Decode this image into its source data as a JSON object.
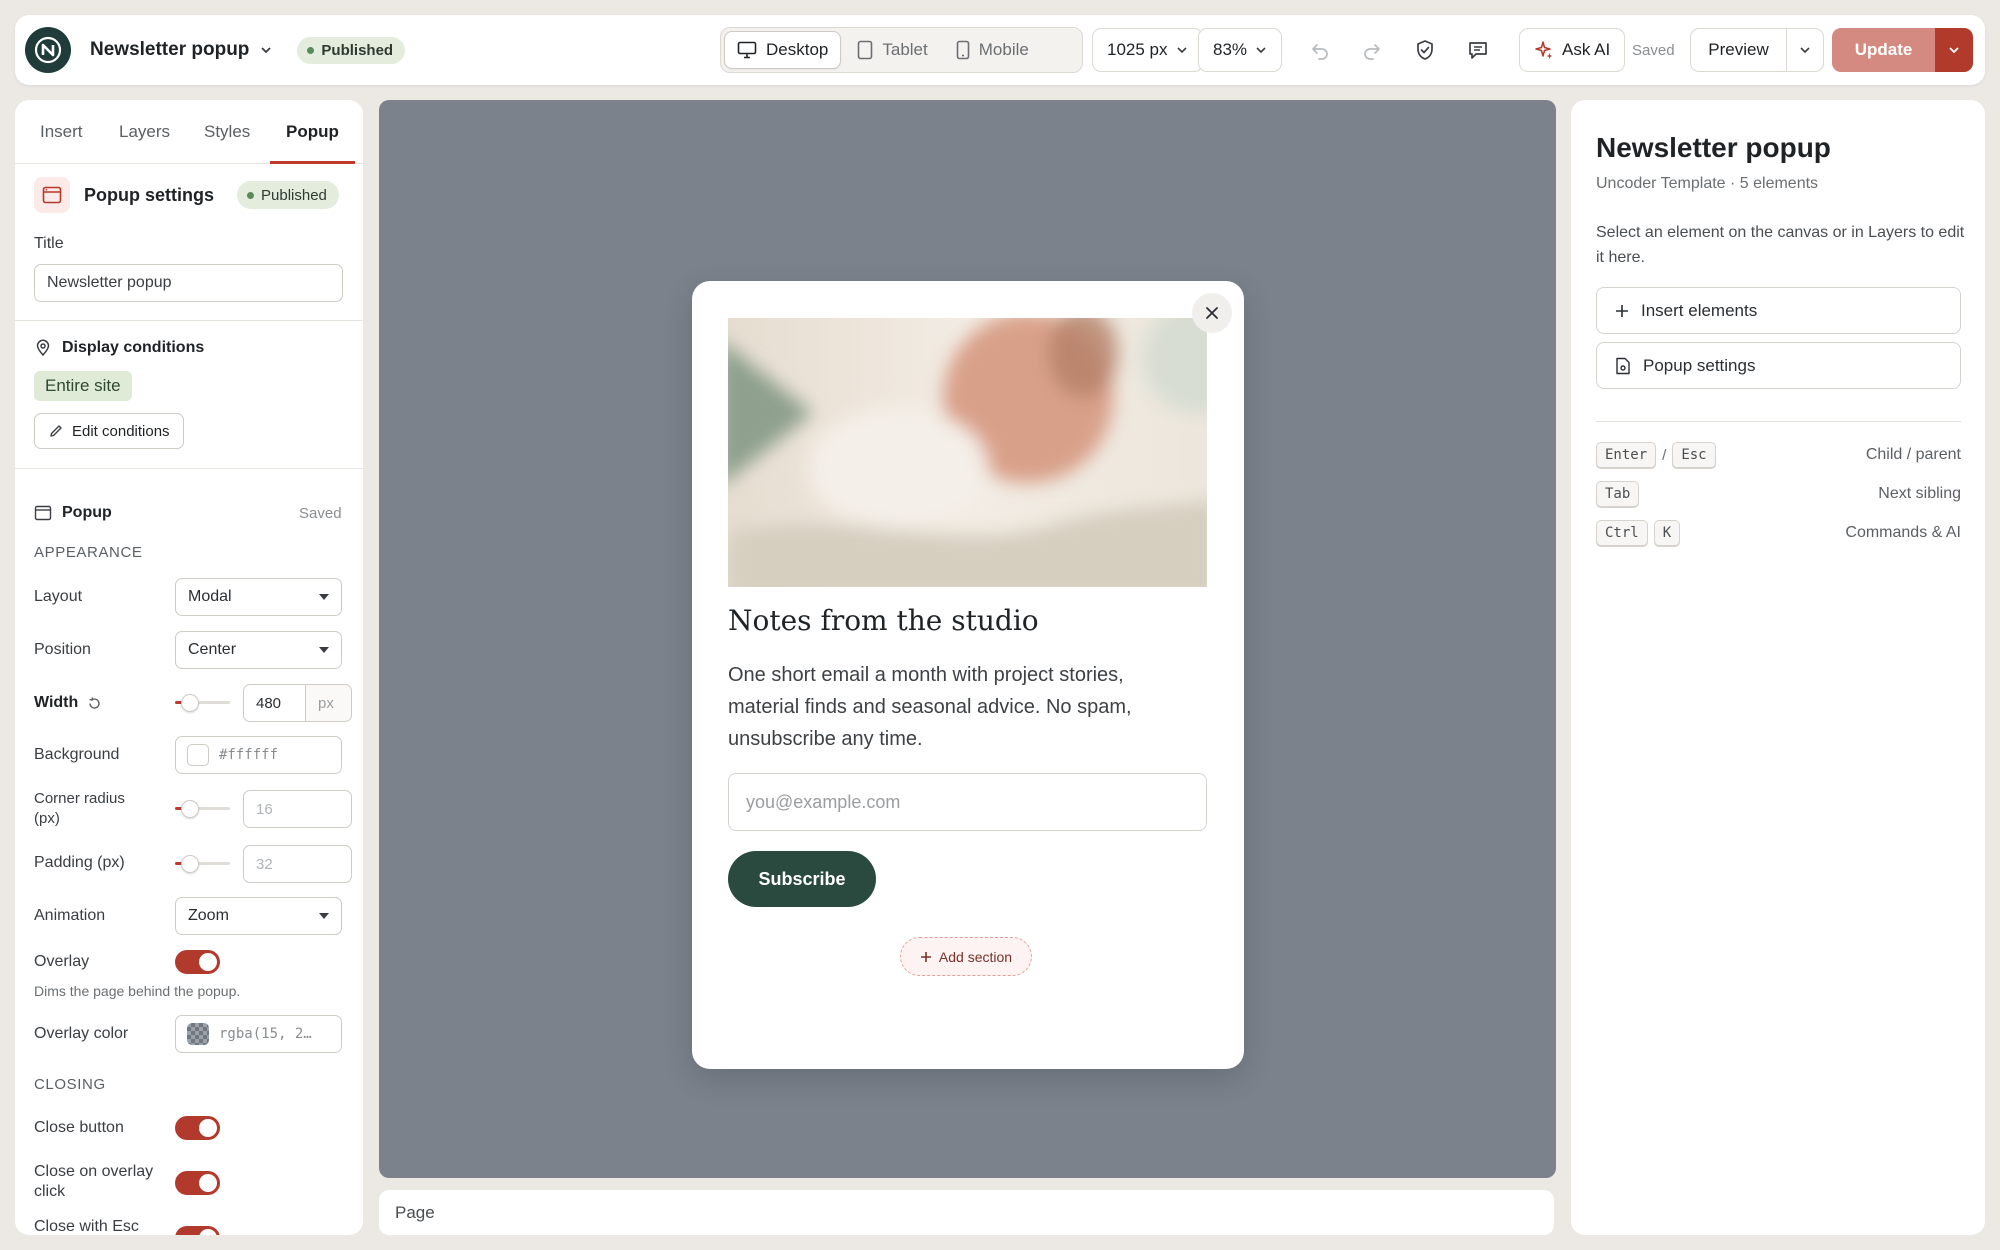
{
  "topbar": {
    "doc_title": "Newsletter popup",
    "status": "Published",
    "devices": [
      "Desktop",
      "Tablet",
      "Mobile"
    ],
    "active_device": "Desktop",
    "canvas_width": "1025 px",
    "zoom": "83%",
    "ask_ai": "Ask AI",
    "saved": "Saved",
    "preview": "Preview",
    "update": "Update"
  },
  "left": {
    "tabs": [
      "Insert",
      "Layers",
      "Styles",
      "Popup"
    ],
    "active_tab": "Popup",
    "settings_title": "Popup settings",
    "settings_status": "Published",
    "title_label": "Title",
    "title_value": "Newsletter popup",
    "display_conditions": "Display conditions",
    "condition_chip": "Entire site",
    "edit_conditions": "Edit conditions",
    "popup_heading": "Popup",
    "popup_saved": "Saved",
    "appearance": "APPEARANCE",
    "layout_label": "Layout",
    "layout_value": "Modal",
    "position_label": "Position",
    "position_value": "Center",
    "width_label": "Width",
    "width_value": "480",
    "width_unit": "px",
    "background_label": "Background",
    "background_value": "#ffffff",
    "radius_label_1": "Corner radius",
    "radius_label_2": "(px)",
    "radius_value": "16",
    "padding_label": "Padding (px)",
    "padding_value": "32",
    "animation_label": "Animation",
    "animation_value": "Zoom",
    "overlay_label": "Overlay",
    "overlay_hint": "Dims the page behind the popup.",
    "overlay_color_label": "Overlay color",
    "overlay_color_value": "rgba(15, 2…",
    "closing": "CLOSING",
    "close_button_label": "Close button",
    "close_overlay_label_1": "Close on overlay",
    "close_overlay_label_2": "click",
    "close_esc_label": "Close with Esc"
  },
  "modal": {
    "title": "Notes from the studio",
    "body": "One short email a month with project stories, material finds and seasonal advice. No spam, unsubscribe any time.",
    "email_placeholder": "you@example.com",
    "subscribe": "Subscribe",
    "add_section": "Add section"
  },
  "page_label": "Page",
  "right": {
    "title": "Newsletter popup",
    "subtitle": "Uncoder Template · 5 elements",
    "hint": "Select an element on the canvas or in Layers to edit it here.",
    "insert_elements": "Insert elements",
    "popup_settings": "Popup settings",
    "shortcuts": {
      "enter": "Enter",
      "slash": "/",
      "esc": "Esc",
      "enter_desc": "Child / parent",
      "tab": "Tab",
      "tab_desc": "Next sibling",
      "ctrl": "Ctrl",
      "k": "K",
      "ctrl_desc": "Commands & AI"
    }
  },
  "colors": {
    "accent": "#b23a2c",
    "update": "#d48a80",
    "brand": "#1f3b3a",
    "subscribe": "#2a4a40",
    "canvas": "#7b828c"
  }
}
